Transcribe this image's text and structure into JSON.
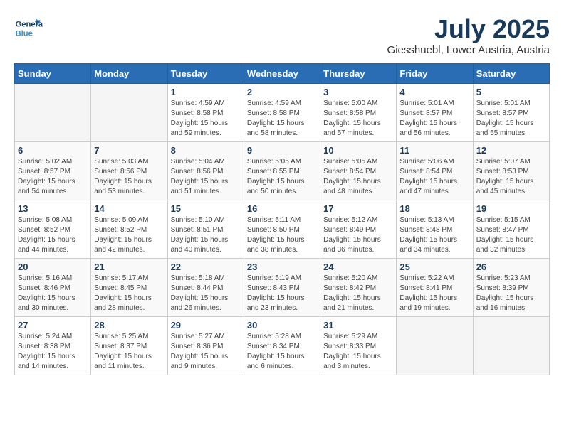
{
  "header": {
    "logo_general": "General",
    "logo_blue": "Blue",
    "month_title": "July 2025",
    "location": "Giesshuebl, Lower Austria, Austria"
  },
  "weekdays": [
    "Sunday",
    "Monday",
    "Tuesday",
    "Wednesday",
    "Thursday",
    "Friday",
    "Saturday"
  ],
  "weeks": [
    [
      {
        "day": "",
        "sunrise": "",
        "sunset": "",
        "daylight": ""
      },
      {
        "day": "",
        "sunrise": "",
        "sunset": "",
        "daylight": ""
      },
      {
        "day": "1",
        "sunrise": "Sunrise: 4:59 AM",
        "sunset": "Sunset: 8:58 PM",
        "daylight": "Daylight: 15 hours and 59 minutes."
      },
      {
        "day": "2",
        "sunrise": "Sunrise: 4:59 AM",
        "sunset": "Sunset: 8:58 PM",
        "daylight": "Daylight: 15 hours and 58 minutes."
      },
      {
        "day": "3",
        "sunrise": "Sunrise: 5:00 AM",
        "sunset": "Sunset: 8:58 PM",
        "daylight": "Daylight: 15 hours and 57 minutes."
      },
      {
        "day": "4",
        "sunrise": "Sunrise: 5:01 AM",
        "sunset": "Sunset: 8:57 PM",
        "daylight": "Daylight: 15 hours and 56 minutes."
      },
      {
        "day": "5",
        "sunrise": "Sunrise: 5:01 AM",
        "sunset": "Sunset: 8:57 PM",
        "daylight": "Daylight: 15 hours and 55 minutes."
      }
    ],
    [
      {
        "day": "6",
        "sunrise": "Sunrise: 5:02 AM",
        "sunset": "Sunset: 8:57 PM",
        "daylight": "Daylight: 15 hours and 54 minutes."
      },
      {
        "day": "7",
        "sunrise": "Sunrise: 5:03 AM",
        "sunset": "Sunset: 8:56 PM",
        "daylight": "Daylight: 15 hours and 53 minutes."
      },
      {
        "day": "8",
        "sunrise": "Sunrise: 5:04 AM",
        "sunset": "Sunset: 8:56 PM",
        "daylight": "Daylight: 15 hours and 51 minutes."
      },
      {
        "day": "9",
        "sunrise": "Sunrise: 5:05 AM",
        "sunset": "Sunset: 8:55 PM",
        "daylight": "Daylight: 15 hours and 50 minutes."
      },
      {
        "day": "10",
        "sunrise": "Sunrise: 5:05 AM",
        "sunset": "Sunset: 8:54 PM",
        "daylight": "Daylight: 15 hours and 48 minutes."
      },
      {
        "day": "11",
        "sunrise": "Sunrise: 5:06 AM",
        "sunset": "Sunset: 8:54 PM",
        "daylight": "Daylight: 15 hours and 47 minutes."
      },
      {
        "day": "12",
        "sunrise": "Sunrise: 5:07 AM",
        "sunset": "Sunset: 8:53 PM",
        "daylight": "Daylight: 15 hours and 45 minutes."
      }
    ],
    [
      {
        "day": "13",
        "sunrise": "Sunrise: 5:08 AM",
        "sunset": "Sunset: 8:52 PM",
        "daylight": "Daylight: 15 hours and 44 minutes."
      },
      {
        "day": "14",
        "sunrise": "Sunrise: 5:09 AM",
        "sunset": "Sunset: 8:52 PM",
        "daylight": "Daylight: 15 hours and 42 minutes."
      },
      {
        "day": "15",
        "sunrise": "Sunrise: 5:10 AM",
        "sunset": "Sunset: 8:51 PM",
        "daylight": "Daylight: 15 hours and 40 minutes."
      },
      {
        "day": "16",
        "sunrise": "Sunrise: 5:11 AM",
        "sunset": "Sunset: 8:50 PM",
        "daylight": "Daylight: 15 hours and 38 minutes."
      },
      {
        "day": "17",
        "sunrise": "Sunrise: 5:12 AM",
        "sunset": "Sunset: 8:49 PM",
        "daylight": "Daylight: 15 hours and 36 minutes."
      },
      {
        "day": "18",
        "sunrise": "Sunrise: 5:13 AM",
        "sunset": "Sunset: 8:48 PM",
        "daylight": "Daylight: 15 hours and 34 minutes."
      },
      {
        "day": "19",
        "sunrise": "Sunrise: 5:15 AM",
        "sunset": "Sunset: 8:47 PM",
        "daylight": "Daylight: 15 hours and 32 minutes."
      }
    ],
    [
      {
        "day": "20",
        "sunrise": "Sunrise: 5:16 AM",
        "sunset": "Sunset: 8:46 PM",
        "daylight": "Daylight: 15 hours and 30 minutes."
      },
      {
        "day": "21",
        "sunrise": "Sunrise: 5:17 AM",
        "sunset": "Sunset: 8:45 PM",
        "daylight": "Daylight: 15 hours and 28 minutes."
      },
      {
        "day": "22",
        "sunrise": "Sunrise: 5:18 AM",
        "sunset": "Sunset: 8:44 PM",
        "daylight": "Daylight: 15 hours and 26 minutes."
      },
      {
        "day": "23",
        "sunrise": "Sunrise: 5:19 AM",
        "sunset": "Sunset: 8:43 PM",
        "daylight": "Daylight: 15 hours and 23 minutes."
      },
      {
        "day": "24",
        "sunrise": "Sunrise: 5:20 AM",
        "sunset": "Sunset: 8:42 PM",
        "daylight": "Daylight: 15 hours and 21 minutes."
      },
      {
        "day": "25",
        "sunrise": "Sunrise: 5:22 AM",
        "sunset": "Sunset: 8:41 PM",
        "daylight": "Daylight: 15 hours and 19 minutes."
      },
      {
        "day": "26",
        "sunrise": "Sunrise: 5:23 AM",
        "sunset": "Sunset: 8:39 PM",
        "daylight": "Daylight: 15 hours and 16 minutes."
      }
    ],
    [
      {
        "day": "27",
        "sunrise": "Sunrise: 5:24 AM",
        "sunset": "Sunset: 8:38 PM",
        "daylight": "Daylight: 15 hours and 14 minutes."
      },
      {
        "day": "28",
        "sunrise": "Sunrise: 5:25 AM",
        "sunset": "Sunset: 8:37 PM",
        "daylight": "Daylight: 15 hours and 11 minutes."
      },
      {
        "day": "29",
        "sunrise": "Sunrise: 5:27 AM",
        "sunset": "Sunset: 8:36 PM",
        "daylight": "Daylight: 15 hours and 9 minutes."
      },
      {
        "day": "30",
        "sunrise": "Sunrise: 5:28 AM",
        "sunset": "Sunset: 8:34 PM",
        "daylight": "Daylight: 15 hours and 6 minutes."
      },
      {
        "day": "31",
        "sunrise": "Sunrise: 5:29 AM",
        "sunset": "Sunset: 8:33 PM",
        "daylight": "Daylight: 15 hours and 3 minutes."
      },
      {
        "day": "",
        "sunrise": "",
        "sunset": "",
        "daylight": ""
      },
      {
        "day": "",
        "sunrise": "",
        "sunset": "",
        "daylight": ""
      }
    ]
  ]
}
